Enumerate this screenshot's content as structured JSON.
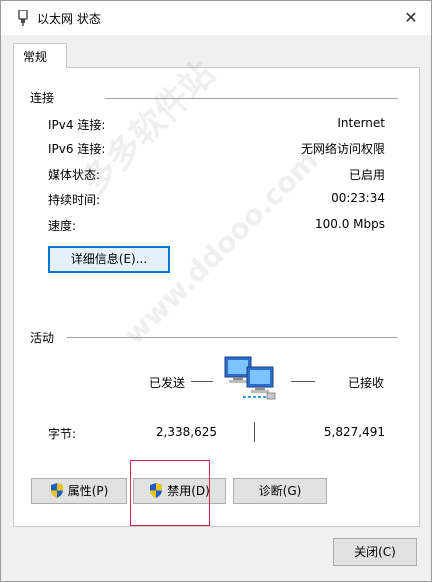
{
  "window": {
    "title": "以太网 状态",
    "close_glyph": "✕"
  },
  "tabs": [
    {
      "label": "常规"
    }
  ],
  "connection": {
    "heading": "连接",
    "rows": [
      {
        "label": "IPv4 连接:",
        "value": "Internet"
      },
      {
        "label": "IPv6 连接:",
        "value": "无网络访问权限"
      },
      {
        "label": "媒体状态:",
        "value": "已启用"
      },
      {
        "label": "持续时间:",
        "value": "00:23:34"
      },
      {
        "label": "速度:",
        "value": "100.0 Mbps"
      }
    ],
    "details_button": "详细信息(E)..."
  },
  "activity": {
    "heading": "活动",
    "sent_label": "已发送",
    "received_label": "已接收",
    "bytes_label": "字节:",
    "bytes_sent": "2,338,625",
    "bytes_received": "5,827,491"
  },
  "buttons": {
    "properties": "属性(P)",
    "disable": "禁用(D)",
    "diagnose": "诊断(G)",
    "close": "关闭(C)"
  },
  "watermark": {
    "text": "多多软件站",
    "url_text": "www.ddooo.com"
  },
  "colors": {
    "focus_border": "#0078d7",
    "highlight_box": "#d72850",
    "shield_blue": "#1f5fbf",
    "shield_yellow": "#f0c419"
  }
}
